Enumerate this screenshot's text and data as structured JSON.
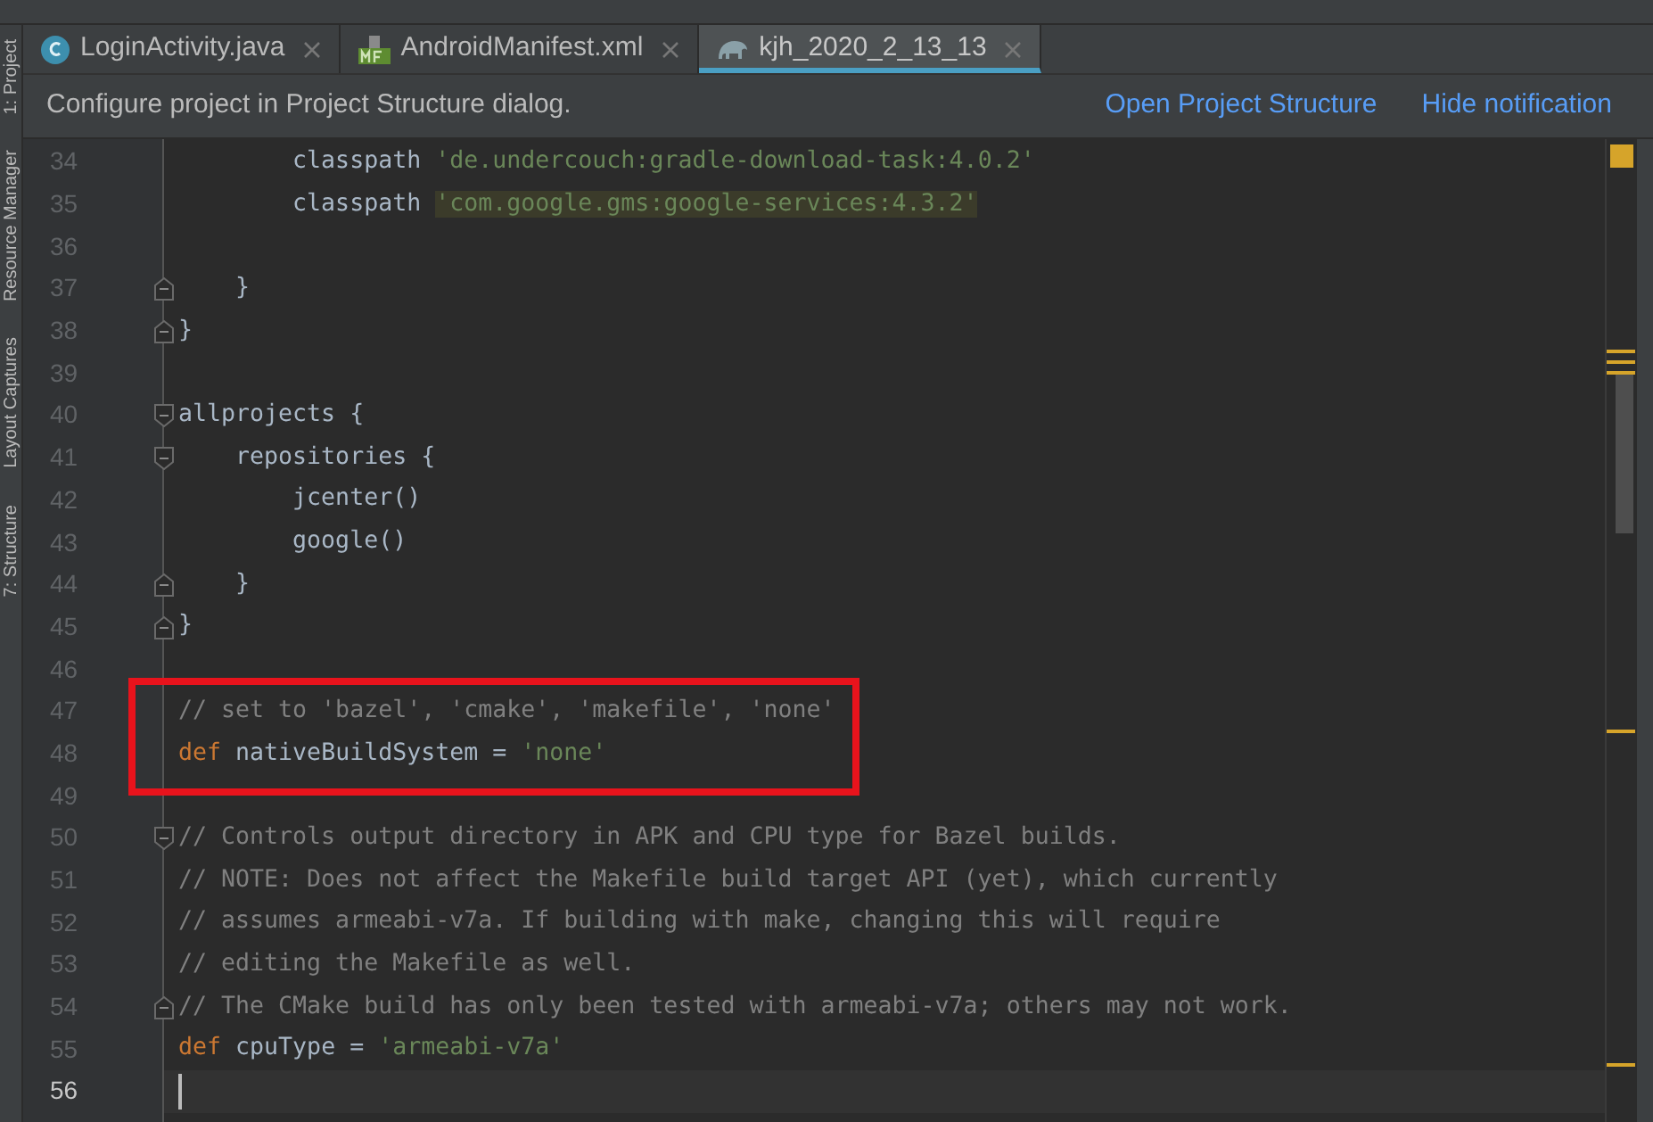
{
  "tool_strip": [
    "1: Project",
    "Resource Manager",
    "Layout Captures",
    "7: Structure"
  ],
  "tabs": [
    {
      "label": "LoginActivity.java",
      "kind": "java",
      "selected": false
    },
    {
      "label": "AndroidManifest.xml",
      "kind": "manifest",
      "selected": false
    },
    {
      "label": "kjh_2020_2_13_13",
      "kind": "gradle",
      "selected": true
    }
  ],
  "notification": {
    "message": "Configure project in Project Structure dialog.",
    "actions": [
      "Open Project Structure",
      "Hide notification"
    ]
  },
  "lines": [
    {
      "number": "34",
      "kind": "code",
      "tokens": [
        {
          "kind": "plain",
          "text": "        classpath "
        },
        {
          "kind": "string",
          "text": "'de.undercouch:gradle-download-task:4.0.2'"
        }
      ]
    },
    {
      "number": "35",
      "kind": "code",
      "tokens": [
        {
          "kind": "plain",
          "text": "        classpath "
        },
        {
          "kind": "string-highlight",
          "text": "'com.google.gms:google-services:4.3.2'"
        }
      ]
    },
    {
      "number": "36",
      "kind": "code"
    },
    {
      "number": "37",
      "kind": "fold-end",
      "tokens": [
        {
          "kind": "plain",
          "text": "    }"
        }
      ]
    },
    {
      "number": "38",
      "kind": "fold-end",
      "tokens": [
        {
          "kind": "plain",
          "text": "}"
        }
      ]
    },
    {
      "number": "39",
      "kind": "code"
    },
    {
      "number": "40",
      "kind": "fold-start",
      "tokens": [
        {
          "kind": "plain",
          "text": "allprojects {"
        }
      ]
    },
    {
      "number": "41",
      "kind": "fold-start",
      "tokens": [
        {
          "kind": "plain",
          "text": "    repositories {"
        }
      ]
    },
    {
      "number": "42",
      "kind": "code",
      "tokens": [
        {
          "kind": "plain",
          "text": "        jcenter()"
        }
      ]
    },
    {
      "number": "43",
      "kind": "code",
      "tokens": [
        {
          "kind": "plain",
          "text": "        google()"
        }
      ]
    },
    {
      "number": "44",
      "kind": "fold-end",
      "tokens": [
        {
          "kind": "plain",
          "text": "    }"
        }
      ]
    },
    {
      "number": "45",
      "kind": "fold-end",
      "tokens": [
        {
          "kind": "plain",
          "text": "}"
        }
      ]
    },
    {
      "number": "46",
      "kind": "code"
    },
    {
      "number": "47",
      "kind": "code",
      "tokens": [
        {
          "kind": "comment",
          "text": "// set to 'bazel', 'cmake', 'makefile', 'none'"
        }
      ]
    },
    {
      "number": "48",
      "kind": "code",
      "tokens": [
        {
          "kind": "keyword",
          "text": "def "
        },
        {
          "kind": "plain",
          "text": "nativeBuildSystem = "
        },
        {
          "kind": "string",
          "text": "'none'"
        }
      ]
    },
    {
      "number": "49",
      "kind": "code"
    },
    {
      "number": "50",
      "kind": "fold-start",
      "tokens": [
        {
          "kind": "comment",
          "text": "// Controls output directory in APK and CPU type for Bazel builds."
        }
      ]
    },
    {
      "number": "51",
      "kind": "code",
      "tokens": [
        {
          "kind": "comment",
          "text": "// NOTE: Does not affect the Makefile build target API (yet), which currently"
        }
      ]
    },
    {
      "number": "52",
      "kind": "code",
      "tokens": [
        {
          "kind": "comment",
          "text": "// assumes armeabi-v7a. If building with make, changing this will require"
        }
      ]
    },
    {
      "number": "53",
      "kind": "code",
      "tokens": [
        {
          "kind": "comment",
          "text": "// editing the Makefile as well."
        }
      ]
    },
    {
      "number": "54",
      "kind": "fold-end",
      "tokens": [
        {
          "kind": "comment",
          "text": "// The CMake build has only been tested with armeabi-v7a; others may not work."
        }
      ]
    },
    {
      "number": "55",
      "kind": "code",
      "tokens": [
        {
          "kind": "keyword",
          "text": "def "
        },
        {
          "kind": "plain",
          "text": "cpuType = "
        },
        {
          "kind": "string",
          "text": "'armeabi-v7a'"
        }
      ]
    },
    {
      "number": "56",
      "kind": "code",
      "current": true
    }
  ]
}
